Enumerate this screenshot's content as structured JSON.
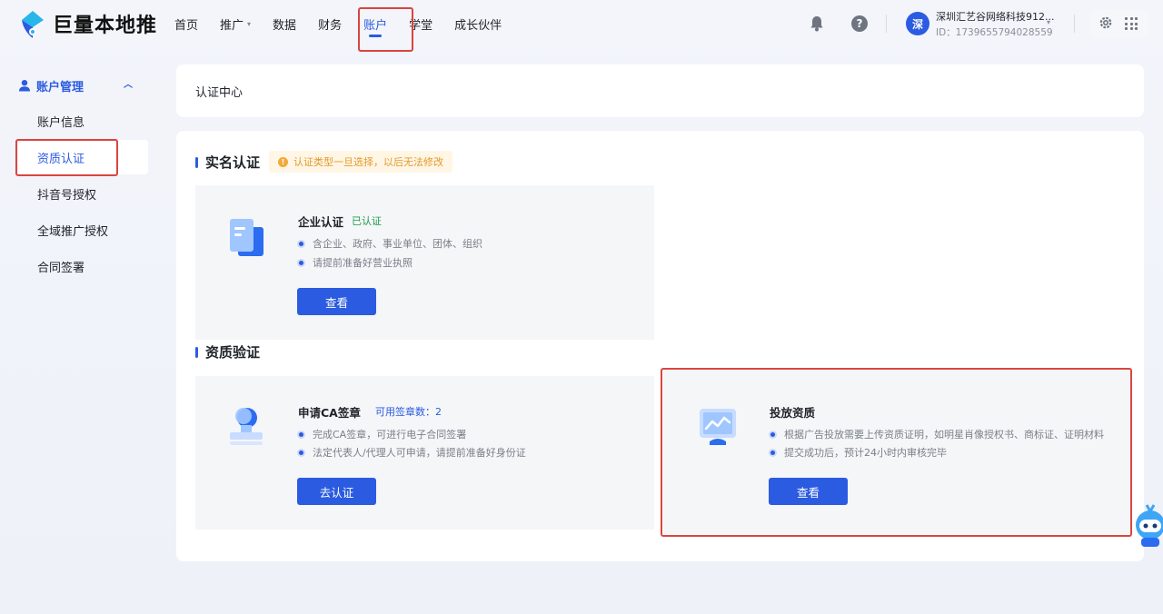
{
  "app": {
    "logo_text": "巨量本地推"
  },
  "nav": {
    "items": [
      {
        "label": "首页"
      },
      {
        "label": "推广",
        "caret": "▾"
      },
      {
        "label": "数据"
      },
      {
        "label": "财务"
      },
      {
        "label": "账户"
      },
      {
        "label": "学堂"
      },
      {
        "label": "成长伙伴"
      }
    ],
    "active_index": 4
  },
  "account": {
    "avatar": "深",
    "name": "深圳汇艺谷网络科技912...",
    "id": "ID：1739655794028559"
  },
  "sidebar": {
    "group_label": "账户管理",
    "items": [
      {
        "label": "账户信息"
      },
      {
        "label": "资质认证"
      },
      {
        "label": "抖音号授权"
      },
      {
        "label": "全域推广授权"
      },
      {
        "label": "合同签署"
      }
    ],
    "active_index": 1
  },
  "page": {
    "title": "认证中心"
  },
  "realname": {
    "section_title": "实名认证",
    "notice": "认证类型一旦选择，以后无法修改",
    "enterprise": {
      "title": "企业认证",
      "status": "已认证",
      "bullets": [
        "含企业、政府、事业单位、团体、组织",
        "请提前准备好营业执照"
      ],
      "button": "查看"
    }
  },
  "qualification": {
    "section_title": "资质验证",
    "ca": {
      "title": "申请CA签章",
      "badge": "可用签章数：2",
      "bullets": [
        "完成CA签章，可进行电子合同签署",
        "法定代表人/代理人可申请，请提前准备好身份证"
      ],
      "button": "去认证"
    },
    "ads": {
      "title": "投放资质",
      "bullets": [
        "根据广告投放需要上传资质证明，如明星肖像授权书、商标证、证明材料",
        "提交成功后，预计24小时内审核完毕"
      ],
      "button": "查看"
    }
  },
  "colors": {
    "accent": "#2b5be0",
    "highlight": "#d9453f",
    "success": "#1a9e4b",
    "warning": "#e29a2c"
  }
}
